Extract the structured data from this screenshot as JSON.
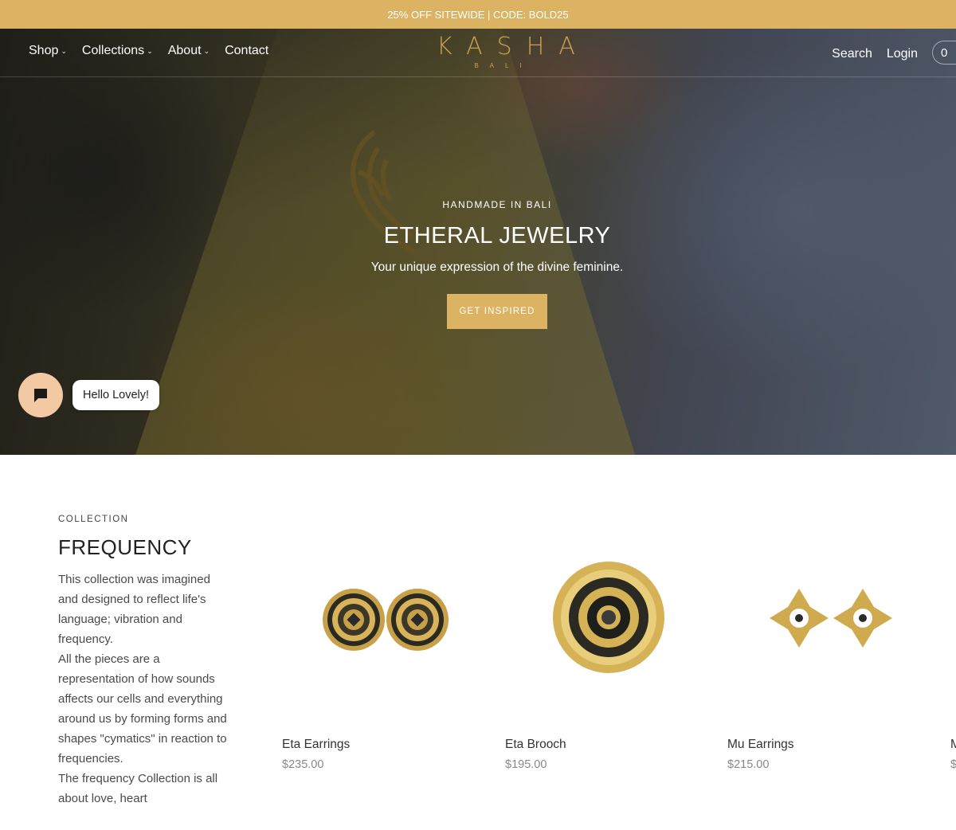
{
  "announcement": {
    "text": "25% OFF SITEWIDE | CODE: BOLD25"
  },
  "header": {
    "nav_left": [
      {
        "label": "Shop",
        "caret": "⌄"
      },
      {
        "label": "Collections",
        "caret": "⌄"
      },
      {
        "label": "About",
        "caret": "⌄"
      },
      {
        "label": "Contact"
      }
    ],
    "logo": {
      "main": "KASHA",
      "sub": "BALI"
    },
    "nav_right": [
      {
        "label": "Search"
      },
      {
        "label": "Login"
      }
    ],
    "cart_count": "0"
  },
  "hero": {
    "eyebrow": "HANDMADE IN BALI",
    "title": "ETHERAL JEWELRY",
    "subtitle": "Your unique expression of the divine feminine.",
    "cta": "GET INSPIRED"
  },
  "chat": {
    "greeting": "Hello Lovely!",
    "icon": "chat-bubble-icon"
  },
  "collection": {
    "eyebrow": "COLLECTION",
    "title": "FREQUENCY",
    "description": [
      "This collection was imagined and designed to reflect life's language; vibration and frequency.",
      "All the pieces are a representation of how sounds affects our cells and everything around us by forming forms and shapes \"cymatics\" in reaction to frequencies.",
      "The frequency Collection is all about love, heart"
    ],
    "products": [
      {
        "name": "Eta Earrings",
        "price": "$235.00"
      },
      {
        "name": "Eta Brooch",
        "price": "$195.00"
      },
      {
        "name": "Mu Earrings",
        "price": "$215.00"
      },
      {
        "name": "M",
        "price": "$"
      }
    ]
  },
  "colors": {
    "accent": "#dcb363",
    "logo": "#c9a052",
    "chat": "#f3c9a4"
  }
}
